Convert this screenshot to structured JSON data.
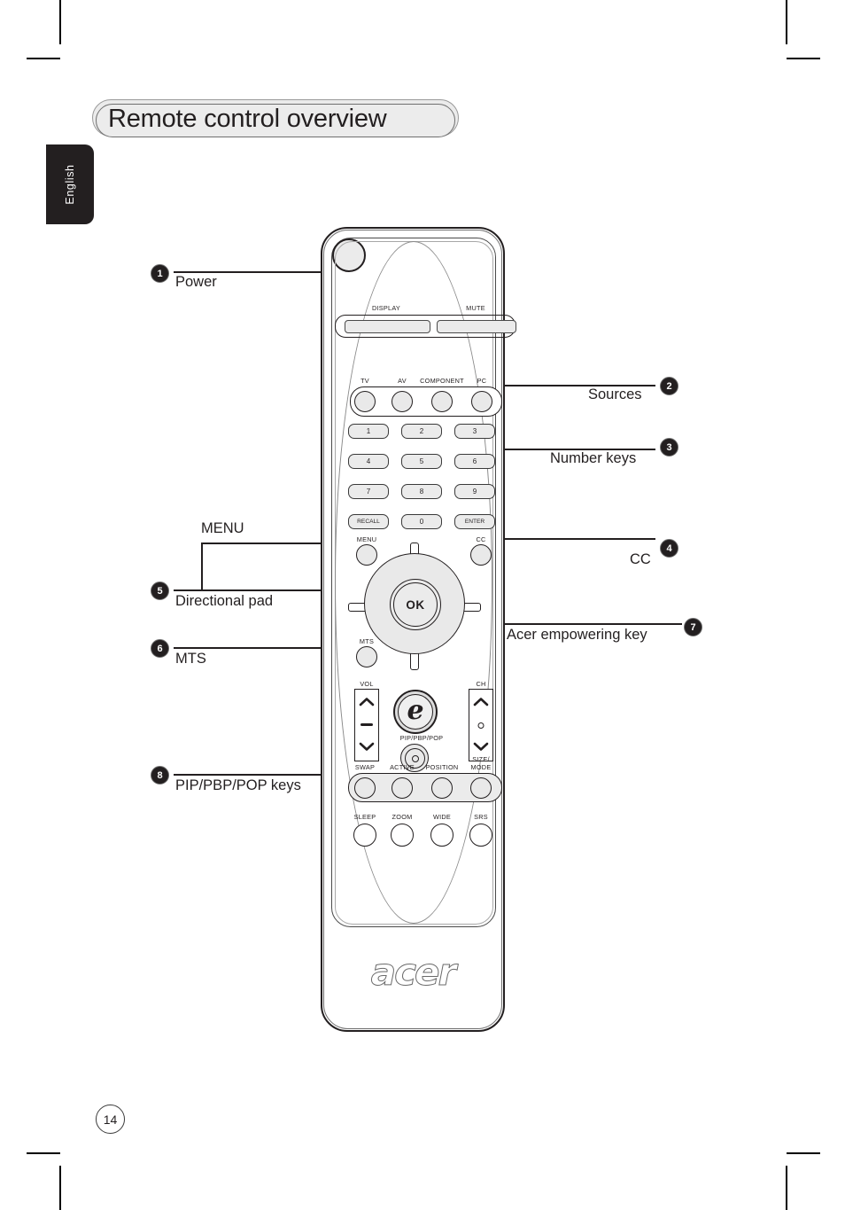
{
  "page": {
    "heading": "Remote control overview",
    "language_tab": "English",
    "page_number": "14"
  },
  "callouts": [
    {
      "num": "1",
      "label": "Power"
    },
    {
      "num": "2",
      "label": "Sources"
    },
    {
      "num": "3",
      "label": "Number keys"
    },
    {
      "num": "4",
      "label": "CC"
    },
    {
      "num": "5",
      "label": "Directional pad"
    },
    {
      "num": "6",
      "label": "MTS"
    },
    {
      "num": "7",
      "label": "Acer empowering key"
    },
    {
      "num": "8",
      "label": "PIP/PBP/POP keys"
    }
  ],
  "extra_labels": {
    "menu": "MENU"
  },
  "remote": {
    "brand": "acer",
    "power_icon": "power-icon",
    "top_pills": [
      {
        "label": "DISPLAY"
      },
      {
        "label": "MUTE"
      }
    ],
    "sources": [
      "TV",
      "AV",
      "COMPONENT",
      "PC"
    ],
    "keypad": [
      [
        "1",
        "2",
        "3"
      ],
      [
        "4",
        "5",
        "6"
      ],
      [
        "7",
        "8",
        "9"
      ],
      [
        "RECALL",
        "0",
        "ENTER"
      ]
    ],
    "menu_button": "MENU",
    "cc_button": "CC",
    "mts_button": "MTS",
    "ok_button": "OK",
    "vol_label": "VOL",
    "ch_label": "CH",
    "pip_label": "PIP/PBP/POP",
    "mode_row": [
      "SWAP",
      "ACTIVE",
      "POSITION",
      "SIZE/\nMODE"
    ],
    "bottom_row": [
      "SLEEP",
      "ZOOM",
      "WIDE",
      "SRS"
    ],
    "size_mode_line1": "SIZE/",
    "size_mode_line2": "MODE"
  },
  "colors": {
    "ink": "#231f20",
    "button_fill": "#e9e9e9",
    "heading_fill": "#ebebeb"
  }
}
